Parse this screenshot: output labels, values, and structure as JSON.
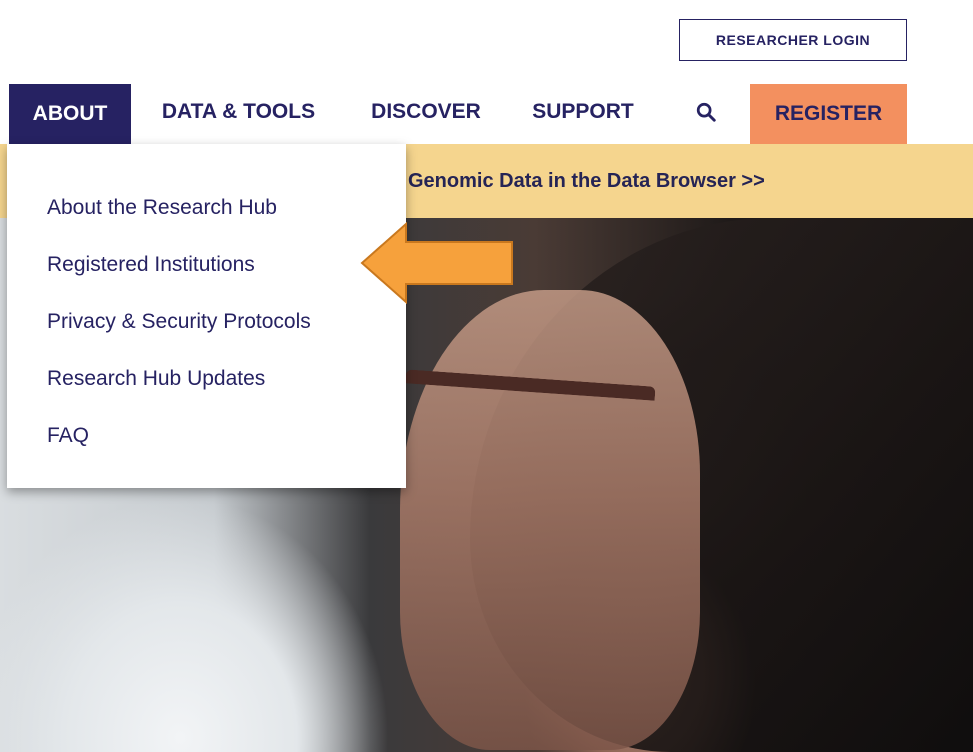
{
  "header": {
    "researcher_login": "RESEARCHER LOGIN"
  },
  "nav": {
    "items": [
      {
        "label": "ABOUT"
      },
      {
        "label": "DATA & TOOLS"
      },
      {
        "label": "DISCOVER"
      },
      {
        "label": "SUPPORT"
      }
    ],
    "search_icon": "search-icon",
    "register": "REGISTER"
  },
  "banner": {
    "text": "Genomic Data in the Data Browser >>"
  },
  "about_menu": {
    "items": [
      {
        "label": "About the Research Hub"
      },
      {
        "label": "Registered Institutions"
      },
      {
        "label": "Privacy & Security Protocols"
      },
      {
        "label": "Research Hub Updates"
      },
      {
        "label": "FAQ"
      }
    ]
  },
  "annotation": {
    "icon": "arrow-left-icon",
    "color": "#f6a13c"
  },
  "colors": {
    "brand_navy": "#262262",
    "register_orange": "#f3905f",
    "banner_yellow": "#f5d58e"
  }
}
